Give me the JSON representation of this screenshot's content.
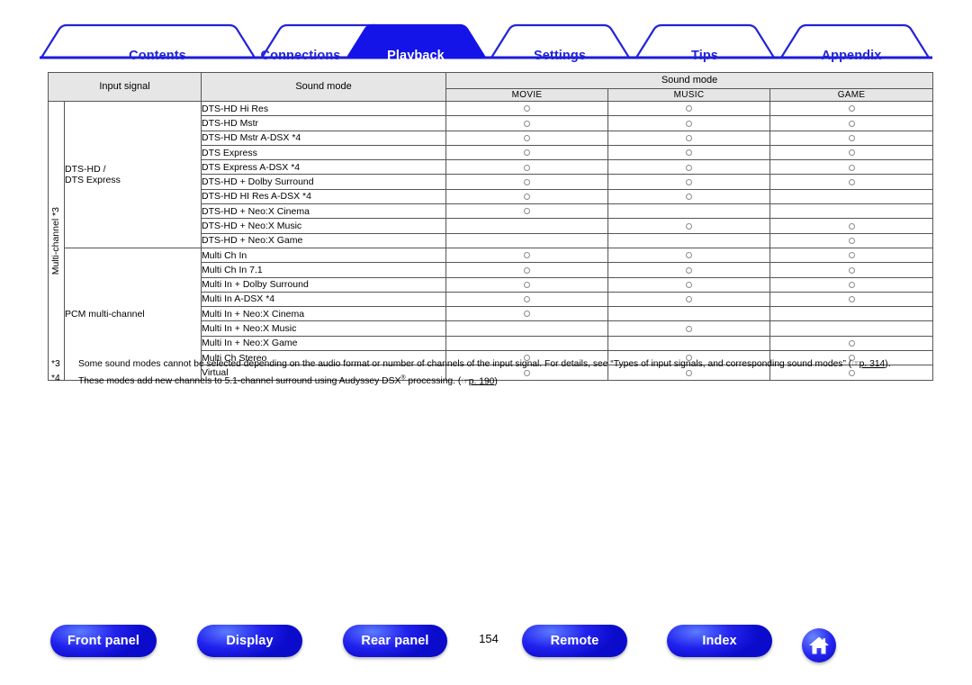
{
  "tabs": [
    {
      "label": "Contents",
      "active": false
    },
    {
      "label": "Connections",
      "active": false
    },
    {
      "label": "Playback",
      "active": true
    },
    {
      "label": "Settings",
      "active": false
    },
    {
      "label": "Tips",
      "active": false
    },
    {
      "label": "Appendix",
      "active": false
    }
  ],
  "table": {
    "header": {
      "input_signal": "Input signal",
      "sound_mode": "Sound mode",
      "sound_mode_group": "Sound mode",
      "columns": [
        "MOVIE",
        "MUSIC",
        "GAME"
      ]
    },
    "vertical_label": "Multi-channel *3",
    "groups": [
      {
        "name": "DTS-HD /\nDTS Express",
        "name_line1": "DTS-HD /",
        "name_line2": "DTS Express",
        "rows": [
          {
            "mode": "DTS-HD Hi Res",
            "movie": true,
            "music": true,
            "game": true
          },
          {
            "mode": "DTS-HD Mstr",
            "movie": true,
            "music": true,
            "game": true
          },
          {
            "mode": "DTS-HD Mstr A-DSX *4",
            "movie": true,
            "music": true,
            "game": true
          },
          {
            "mode": "DTS Express",
            "movie": true,
            "music": true,
            "game": true
          },
          {
            "mode": "DTS Express A-DSX *4",
            "movie": true,
            "music": true,
            "game": true
          },
          {
            "mode": "DTS-HD + Dolby Surround",
            "movie": true,
            "music": true,
            "game": true
          },
          {
            "mode": "DTS-HD HI Res A-DSX *4",
            "movie": true,
            "music": true,
            "game": false
          },
          {
            "mode": "DTS-HD + Neo:X Cinema",
            "movie": true,
            "music": false,
            "game": false
          },
          {
            "mode": "DTS-HD + Neo:X Music",
            "movie": false,
            "music": true,
            "game": true
          },
          {
            "mode": "DTS-HD + Neo:X Game",
            "movie": false,
            "music": false,
            "game": true
          }
        ]
      },
      {
        "name": "PCM multi-channel",
        "name_line1": "PCM multi-channel",
        "name_line2": "",
        "rows": [
          {
            "mode": "Multi Ch In",
            "movie": true,
            "music": true,
            "game": true
          },
          {
            "mode": "Multi Ch In 7.1",
            "movie": true,
            "music": true,
            "game": true
          },
          {
            "mode": "Multi In + Dolby Surround",
            "movie": true,
            "music": true,
            "game": true
          },
          {
            "mode": "Multi In A-DSX *4",
            "movie": true,
            "music": true,
            "game": true
          },
          {
            "mode": "Multi In + Neo:X Cinema",
            "movie": true,
            "music": false,
            "game": false
          },
          {
            "mode": "Multi In + Neo:X Music",
            "movie": false,
            "music": true,
            "game": false
          },
          {
            "mode": "Multi In + Neo:X Game",
            "movie": false,
            "music": false,
            "game": true
          },
          {
            "mode": "Multi Ch Stereo",
            "movie": true,
            "music": true,
            "game": true
          },
          {
            "mode": "Virtual",
            "movie": true,
            "music": true,
            "game": true
          }
        ]
      }
    ]
  },
  "footnotes": [
    {
      "mark": "*3",
      "text_before": "Some sound modes cannot be selected depending on the audio format or number of channels of the input signal. For details, see “Types of input signals, and corresponding sound modes” (",
      "link": "p. 314",
      "text_after": ")."
    },
    {
      "mark": "*4",
      "text_before": "These modes add new channels to 5.1-channel surround using Audyssey DSX® processing. (",
      "link": "p. 190",
      "text_after": ")"
    }
  ],
  "bottom_nav": {
    "buttons": [
      {
        "label": "Front panel"
      },
      {
        "label": "Display"
      },
      {
        "label": "Rear panel"
      },
      {
        "label": "Remote"
      },
      {
        "label": "Index"
      }
    ],
    "page_number": "154",
    "home_icon": "home-icon"
  },
  "colors": {
    "accent": "#2323d8",
    "active_tab_bg": "#1414e8",
    "header_bg": "#e6e6e6",
    "border": "#555555",
    "circle": "#8a8a8a"
  }
}
